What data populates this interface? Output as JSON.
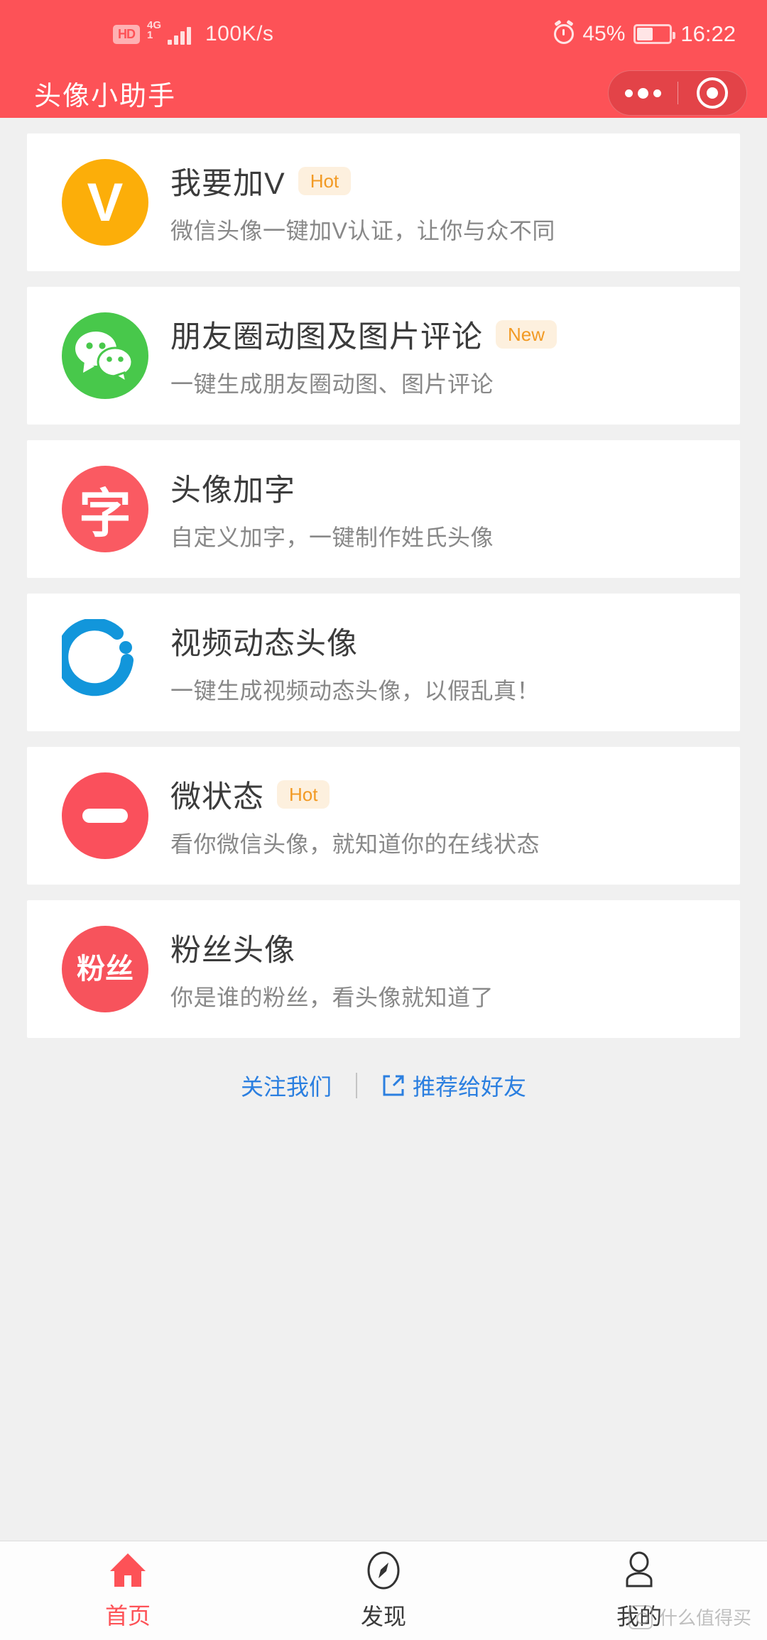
{
  "status_bar": {
    "hd_label": "HD",
    "network_type": "4G",
    "network_type_sub": "1",
    "speed": "100K/s",
    "alarm_icon": "alarm-icon",
    "battery_percent": "45%",
    "battery_level": 45,
    "time": "16:22"
  },
  "header": {
    "title": "头像小助手",
    "accent_color": "#FD5257",
    "capsule": {
      "more_icon": "more-dots-icon",
      "close_icon": "target-circle-icon"
    }
  },
  "cards": [
    {
      "icon_name": "v-badge-icon",
      "icon_text": "V",
      "icon_color": "#FCAE09",
      "title": "我要加V",
      "badge": "Hot",
      "subtitle": "微信头像一键加V认证，让你与众不同"
    },
    {
      "icon_name": "wechat-icon",
      "icon_text": "",
      "icon_color": "#48C84B",
      "title": "朋友圈动图及图片评论",
      "badge": "New",
      "subtitle": "一键生成朋友圈动图、图片评论"
    },
    {
      "icon_name": "character-zi-icon",
      "icon_text": "字",
      "icon_color": "#FA5A62",
      "title": "头像加字",
      "badge": "",
      "subtitle": "自定义加字，一键制作姓氏头像"
    },
    {
      "icon_name": "loading-spinner-icon",
      "icon_text": "",
      "icon_color": "#1296DB",
      "title": "视频动态头像",
      "badge": "",
      "subtitle": "一键生成视频动态头像，以假乱真！"
    },
    {
      "icon_name": "minus-circle-icon",
      "icon_text": "",
      "icon_color": "#FA505C",
      "title": "微状态",
      "badge": "Hot",
      "subtitle": "看你微信头像，就知道你的在线状态"
    },
    {
      "icon_name": "fans-icon",
      "icon_text": "粉丝",
      "icon_color": "#F7535C",
      "title": "粉丝头像",
      "badge": "",
      "subtitle": "你是谁的粉丝，看头像就知道了"
    }
  ],
  "footer_links": {
    "follow": "关注我们",
    "share": "推荐给好友",
    "share_icon": "share-arrow-icon",
    "link_color": "#2B7FE0"
  },
  "tabbar": {
    "active_color": "#FD5257",
    "items": [
      {
        "icon_name": "home-icon",
        "label": "首页",
        "active": true
      },
      {
        "icon_name": "compass-icon",
        "label": "发现",
        "active": false
      },
      {
        "icon_name": "person-icon",
        "label": "我的",
        "active": false
      }
    ]
  },
  "watermark": {
    "text": "什么值得买",
    "icon_name": "smzdm-logo-icon"
  }
}
